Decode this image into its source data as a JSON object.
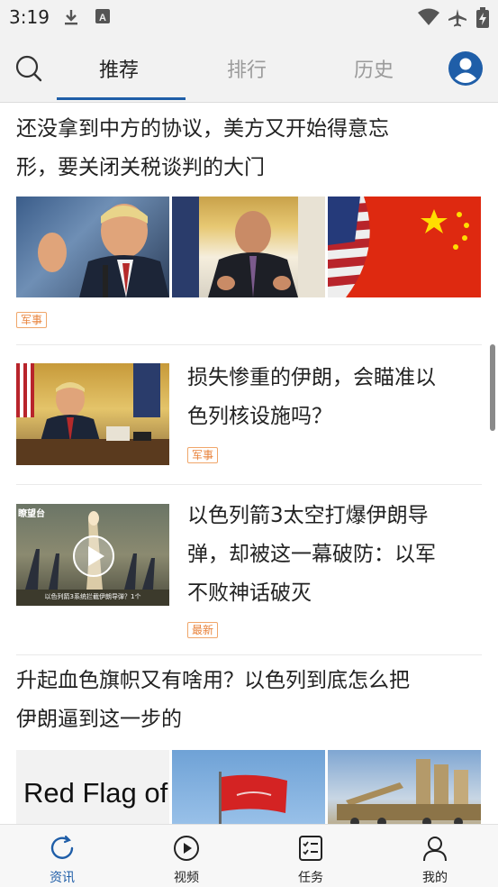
{
  "status_bar": {
    "time": "3:19",
    "left_icons": [
      "download-icon",
      "a-notification-icon"
    ],
    "right_icons": [
      "wifi-icon",
      "airplane-mode-icon",
      "battery-charging-icon"
    ]
  },
  "top_nav": {
    "search_icon": "search-icon",
    "tabs": [
      {
        "label": "推荐",
        "active": true
      },
      {
        "label": "排行",
        "active": false
      },
      {
        "label": "历史",
        "active": false
      }
    ],
    "profile_icon": "user-avatar-icon",
    "accent_color": "#1f5ea8"
  },
  "feed": {
    "items": [
      {
        "layout": "three-images",
        "title_line1": "还没拿到中方的协议，美方又开始得意忘",
        "title_line2": "形，要关闭关税谈判的大门",
        "tag": "军事",
        "images": [
          "speaker-at-microphone-photo",
          "man-speaking-in-office-photo",
          "us-china-flags-photo"
        ]
      },
      {
        "layout": "left-image",
        "title_line1": "损失惨重的伊朗，会瞄准以",
        "title_line2": "色列核设施吗？",
        "tag": "军事",
        "image": "man-at-desk-with-flags-photo"
      },
      {
        "layout": "left-image-video",
        "title_line1": "以色列箭3太空打爆伊朗导",
        "title_line2": "弹，却被这一幕破防：以军",
        "title_line3": "不败神话破灭",
        "tag": "最新",
        "image": "missile-launch-video-thumbnail",
        "video_overlay_top": "瞭望台",
        "video_overlay_caption": "以色列箭3系统拦截伊朗导弹？1个"
      },
      {
        "layout": "three-images",
        "title_line1": "升起血色旗帜又有啥用？以色列到底怎么把",
        "title_line2": "伊朗逼到这一步的",
        "images": [
          "red-flag-text-image",
          "red-flag-on-pole-photo",
          "missile-launchers-photo"
        ],
        "image1_text": "Red Flag of"
      }
    ]
  },
  "bottom_nav": {
    "items": [
      {
        "label": "资讯",
        "icon": "refresh-icon",
        "active": true
      },
      {
        "label": "视频",
        "icon": "play-circle-icon",
        "active": false
      },
      {
        "label": "任务",
        "icon": "checklist-icon",
        "active": false
      },
      {
        "label": "我的",
        "icon": "person-icon",
        "active": false
      }
    ]
  }
}
